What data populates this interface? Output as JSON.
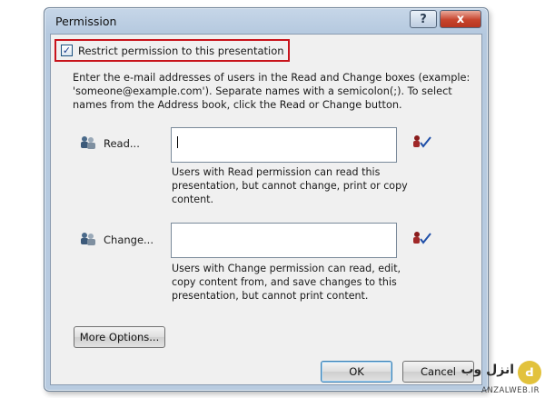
{
  "window": {
    "title": "Permission",
    "help_label": "?",
    "close_label": "x"
  },
  "restrict": {
    "checked": true,
    "label": "Restrict permission to this presentation"
  },
  "instructions": "Enter the e-mail addresses of users in the Read and Change boxes (example: 'someone@example.com'). Separate names with a semicolon(;). To select names from the Address book, click the Read or Change button.",
  "read": {
    "label": "Read...",
    "value": "",
    "note": "Users with Read permission can read this presentation, but cannot change, print or copy content."
  },
  "change": {
    "label": "Change...",
    "value": "",
    "note": "Users with Change permission can read, edit, copy content from, and save changes to this presentation, but cannot print content."
  },
  "buttons": {
    "more_options": "More Options...",
    "ok": "OK",
    "cancel": "Cancel"
  },
  "watermark": {
    "badge": "ꓒ",
    "text": "انزل وب",
    "site": "ANZALWEB.IR"
  },
  "icons": {
    "read_icon": "people-icon",
    "change_icon": "people-icon",
    "address_book_icon": "address-book-check-icon"
  }
}
